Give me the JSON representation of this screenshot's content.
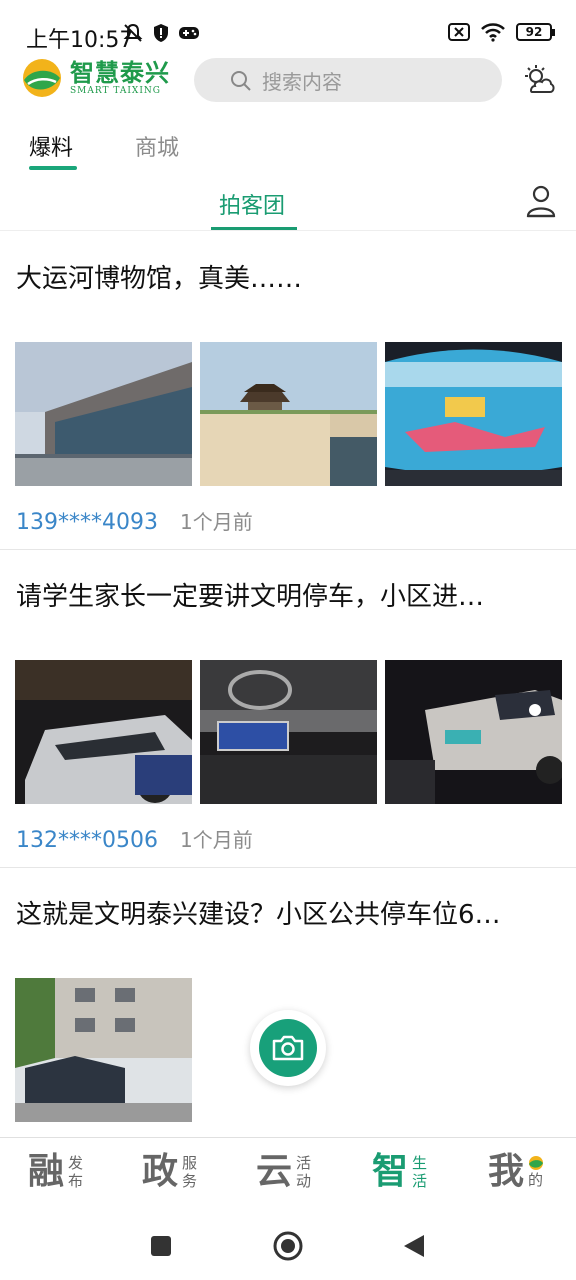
{
  "status": {
    "time": "上午10:57",
    "battery": "92"
  },
  "header": {
    "logo_cn": "智慧泰兴",
    "logo_en": "SMART TAIXING",
    "search_placeholder": "搜索内容"
  },
  "top_tabs": [
    {
      "label": "爆料"
    },
    {
      "label": "商城"
    }
  ],
  "sub_tabs": [
    {
      "label": "拍客团"
    }
  ],
  "posts": [
    {
      "title": "大运河博物馆，真美……",
      "user": "139****4093",
      "time": "1个月前"
    },
    {
      "title": "请学生家长一定要讲文明停车，小区进…",
      "user": "132****0506",
      "time": "1个月前"
    },
    {
      "title": "这就是文明泰兴建设？小区公共停车位6…",
      "user": "",
      "time": ""
    }
  ],
  "bottom_nav": [
    {
      "big": "融",
      "small1": "发",
      "small2": "布"
    },
    {
      "big": "政",
      "small1": "服",
      "small2": "务"
    },
    {
      "big": "云",
      "small1": "活",
      "small2": "动"
    },
    {
      "big": "智",
      "small1": "生",
      "small2": "活"
    },
    {
      "big": "我",
      "small1": "",
      "small2": "的"
    }
  ],
  "colors": {
    "accent": "#1a9c72",
    "user_link": "#3a86c8",
    "logo_green": "#1f9a4b"
  }
}
